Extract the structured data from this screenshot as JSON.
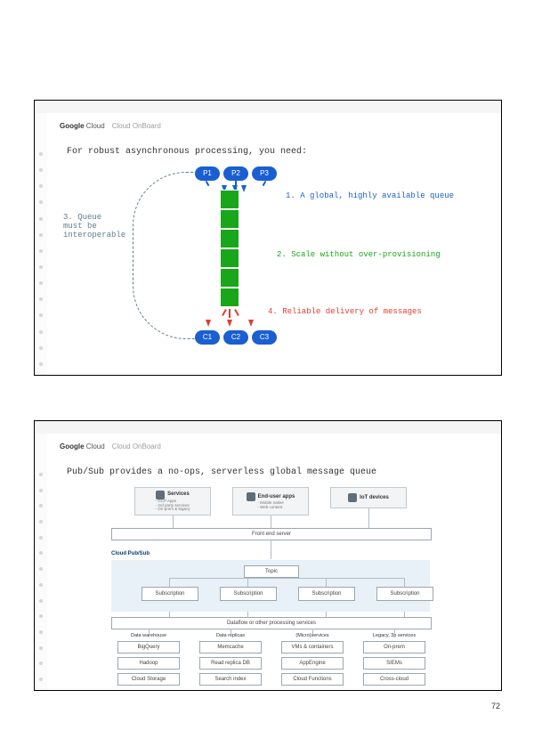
{
  "page_number": "72",
  "brand": {
    "g": "Google",
    "c": "Cloud",
    "ob": "Cloud OnBoard"
  },
  "slide1": {
    "title": "For robust asynchronous processing, you need:",
    "producers": [
      "P1",
      "P2",
      "P3"
    ],
    "consumers": [
      "C1",
      "C2",
      "C3"
    ],
    "ann1": "1. A global, highly available queue",
    "ann2": "2. Scale without over-provisioning",
    "ann3line1": "3. Queue",
    "ann3line2": "must be",
    "ann3line3": "interoperable",
    "ann4": "4. Reliable delivery of messages"
  },
  "slide2": {
    "title": "Pub/Sub provides a no-ops, serverless global message queue",
    "top": {
      "services": {
        "title": "Services",
        "items": "- GCP Apps\n- 3rd party services\n- On-prem & legacy"
      },
      "enduser": {
        "title": "End-user apps",
        "items": "- Mobile native\n- Web content"
      },
      "iot": {
        "title": "IoT devices"
      }
    },
    "frontend": "Front end server",
    "pubsub": "Cloud Pub/Sub",
    "topic": "Topic",
    "subscription": "Subscription",
    "dataflow": "Dataflow or other processing services",
    "cols": {
      "dw": {
        "title": "Data warehouse",
        "items": [
          "BigQuery",
          "Hadoop",
          "Cloud Storage"
        ]
      },
      "dr": {
        "title": "Data replicas",
        "items": [
          "Memcache",
          "Read replica DB",
          "Search index"
        ]
      },
      "ms": {
        "title": "(Micro)services",
        "items": [
          "VMs & containers",
          "AppEngine",
          "Cloud Functions"
        ]
      },
      "lg": {
        "title": "Legacy, 3p services",
        "items": [
          "On-prem",
          "SIEMs",
          "Cross-cloud"
        ]
      }
    }
  }
}
